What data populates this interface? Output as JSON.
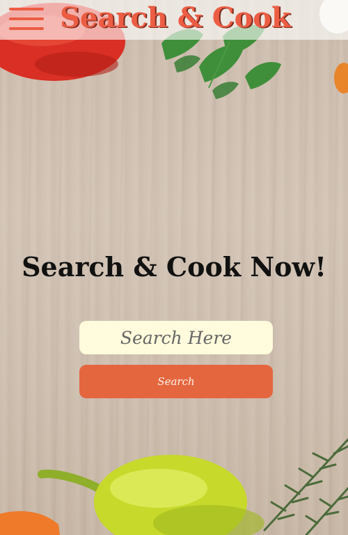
{
  "header": {
    "brand": "Search & Cook",
    "menu_icon": "hamburger-menu-icon"
  },
  "hero": {
    "headline": "Search & Cook Now!"
  },
  "search": {
    "placeholder": "Search Here",
    "value": "",
    "button_label": "Search"
  },
  "colors": {
    "accent": "#ec5d43",
    "button": "#e4663f",
    "input_bg": "#fffbdc",
    "background_wood": "#d3c4b5"
  }
}
